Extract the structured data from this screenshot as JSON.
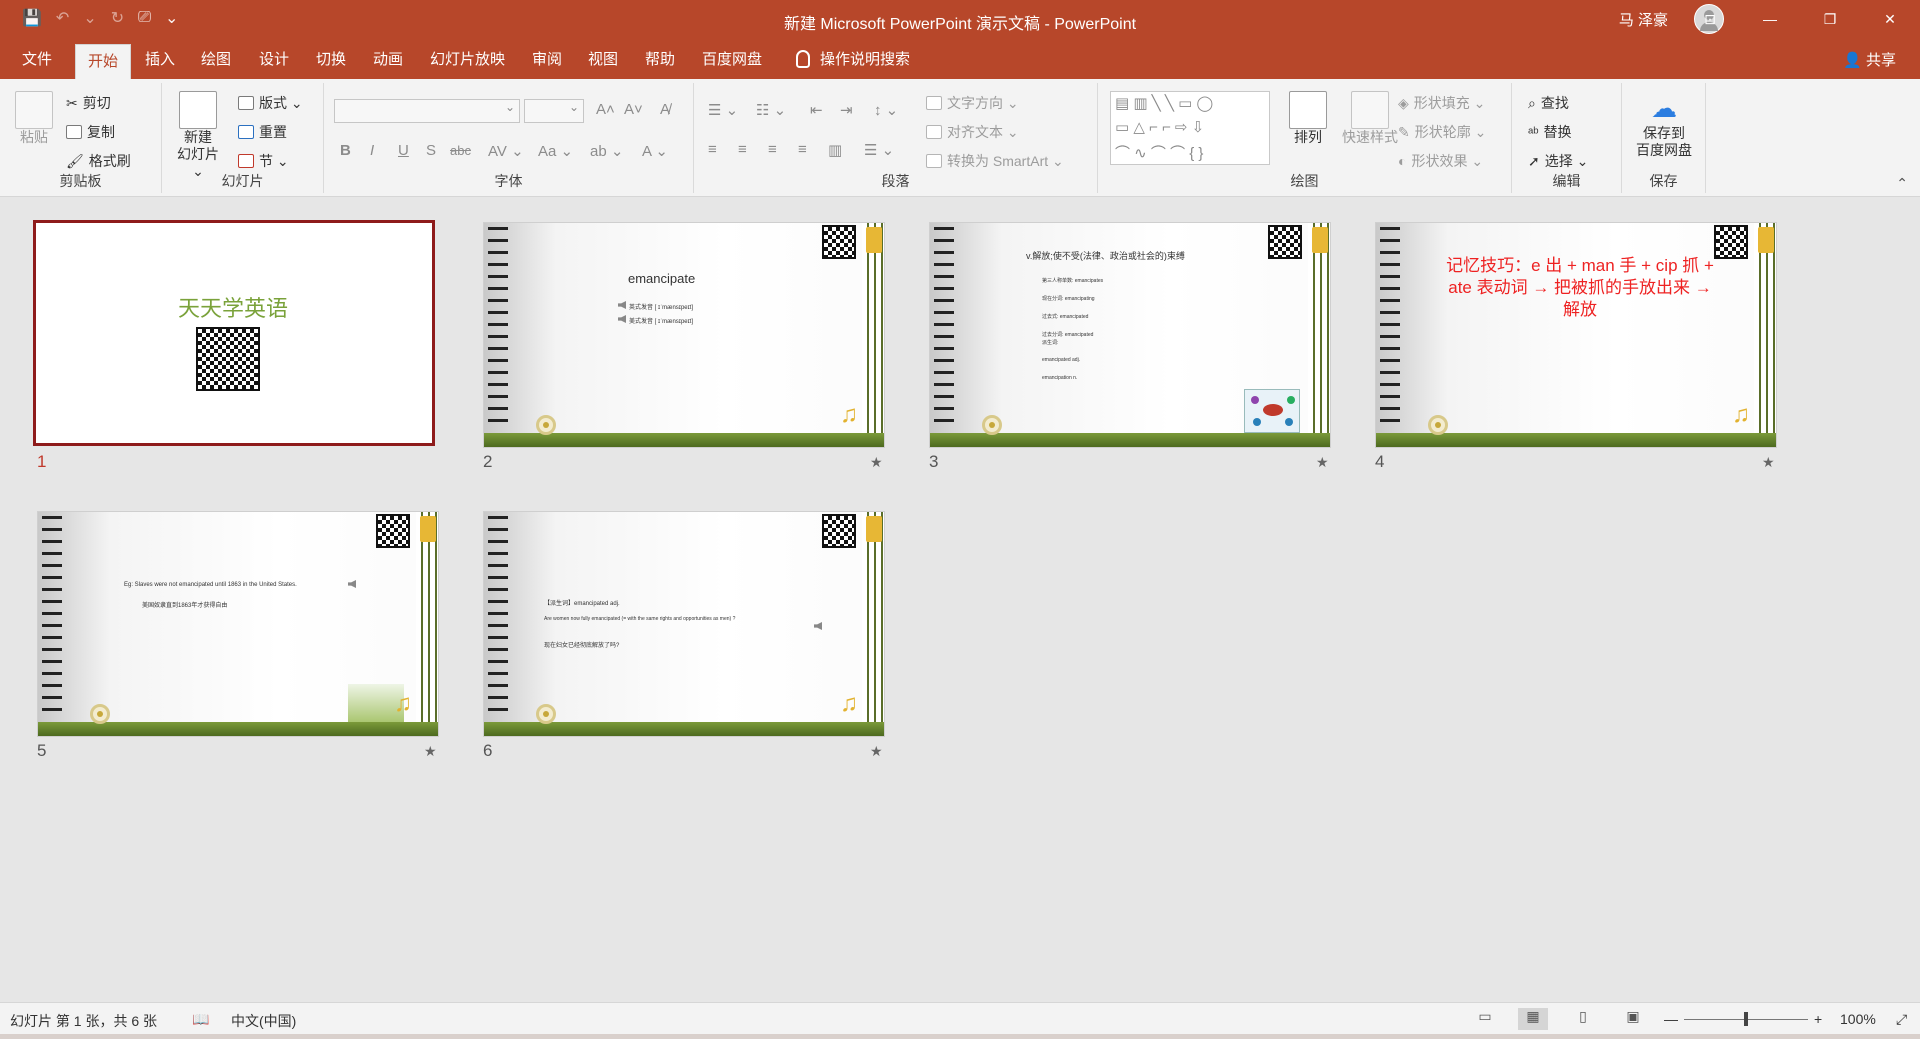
{
  "window": {
    "title": "新建 Microsoft PowerPoint 演示文稿  -  PowerPoint",
    "user": "马 泽豪",
    "controls": [
      "⊡",
      "—",
      "❐",
      "✕"
    ]
  },
  "qat": [
    "💾",
    "↶",
    "⌄",
    "↻",
    "⎚",
    "⌄"
  ],
  "menu": {
    "tabs": [
      "文件",
      "开始",
      "插入",
      "绘图",
      "设计",
      "切换",
      "动画",
      "幻灯片放映",
      "审阅",
      "视图",
      "帮助",
      "百度网盘"
    ],
    "active": "开始",
    "tell_me": "操作说明搜索",
    "share": "共享"
  },
  "ribbon": {
    "clipboard": {
      "label": "剪贴板",
      "paste": "粘贴",
      "cut": "剪切",
      "copy": "复制",
      "format_painter": "格式刷"
    },
    "slides": {
      "label": "幻灯片",
      "new_slide_1": "新建",
      "new_slide_2": "幻灯片 ⌄",
      "layout": "版式 ⌄",
      "reset": "重置",
      "section": "节 ⌄"
    },
    "font": {
      "label": "字体",
      "grow": "A˄",
      "shrink": "A˅",
      "clear": "A̸",
      "bold": "B",
      "italic": "I",
      "underline": "U",
      "shadow": "S",
      "strike": "abc",
      "spacing": "AV ⌄",
      "case": "Aa ⌄",
      "highlight": "ab ⌄",
      "color": "A ⌄"
    },
    "paragraph": {
      "label": "段落",
      "text_direction": "文字方向 ⌄",
      "align_text": "对齐文本 ⌄",
      "smartart": "转换为 SmartArt ⌄"
    },
    "drawing": {
      "label": "绘图",
      "arrange": "排列",
      "quick_styles": "快速样式",
      "fill": "形状填充 ⌄",
      "outline": "形状轮廓 ⌄",
      "effects": "形状效果 ⌄"
    },
    "editing": {
      "label": "编辑",
      "find": "查找",
      "replace": "替换",
      "select": "选择 ⌄"
    },
    "save": {
      "label": "保存",
      "save_1": "保存到",
      "save_2": "百度网盘"
    }
  },
  "slides": [
    {
      "number": "1",
      "selected": true,
      "title": "天天学英语"
    },
    {
      "number": "2",
      "word": "emancipate",
      "lines": [
        "英式发音   [ ɪˈmænsɪpeɪt]",
        "美式发音   [ ɪˈmænsɪpeɪt]"
      ]
    },
    {
      "number": "3",
      "title": "v.解放;使不受(法律、政治或社会的)束缚",
      "lines": [
        "第三人称单数:    emancipates",
        "现在分词:    emancipating",
        "过去式:    emancipated",
        "过去分词:    emancipated",
        "派生词:",
        "emancipated adj.",
        "emancipation n."
      ]
    },
    {
      "number": "4",
      "text": "记忆技巧：e 出 + man 手 + cip 抓 + ate 表动词 → 把被抓的手放出来 → 解放"
    },
    {
      "number": "5",
      "lines": [
        "Eg:   Slaves were not emancipated until 1863 in the United States.",
        "美国奴隶直到1863年才获得自由"
      ]
    },
    {
      "number": "6",
      "lines": [
        "【派生词】emancipated adj.",
        "Are women now fully emancipated (= with the same rights and opportunities as men) ?",
        "现在妇女已经彻底解放了吗?"
      ]
    }
  ],
  "star_glyph": "★",
  "status": {
    "slide_info": "幻灯片 第 1 张，共 6 张",
    "language": "中文(中国)",
    "zoom": "100%",
    "zoom_minus": "—",
    "zoom_plus": "+"
  }
}
